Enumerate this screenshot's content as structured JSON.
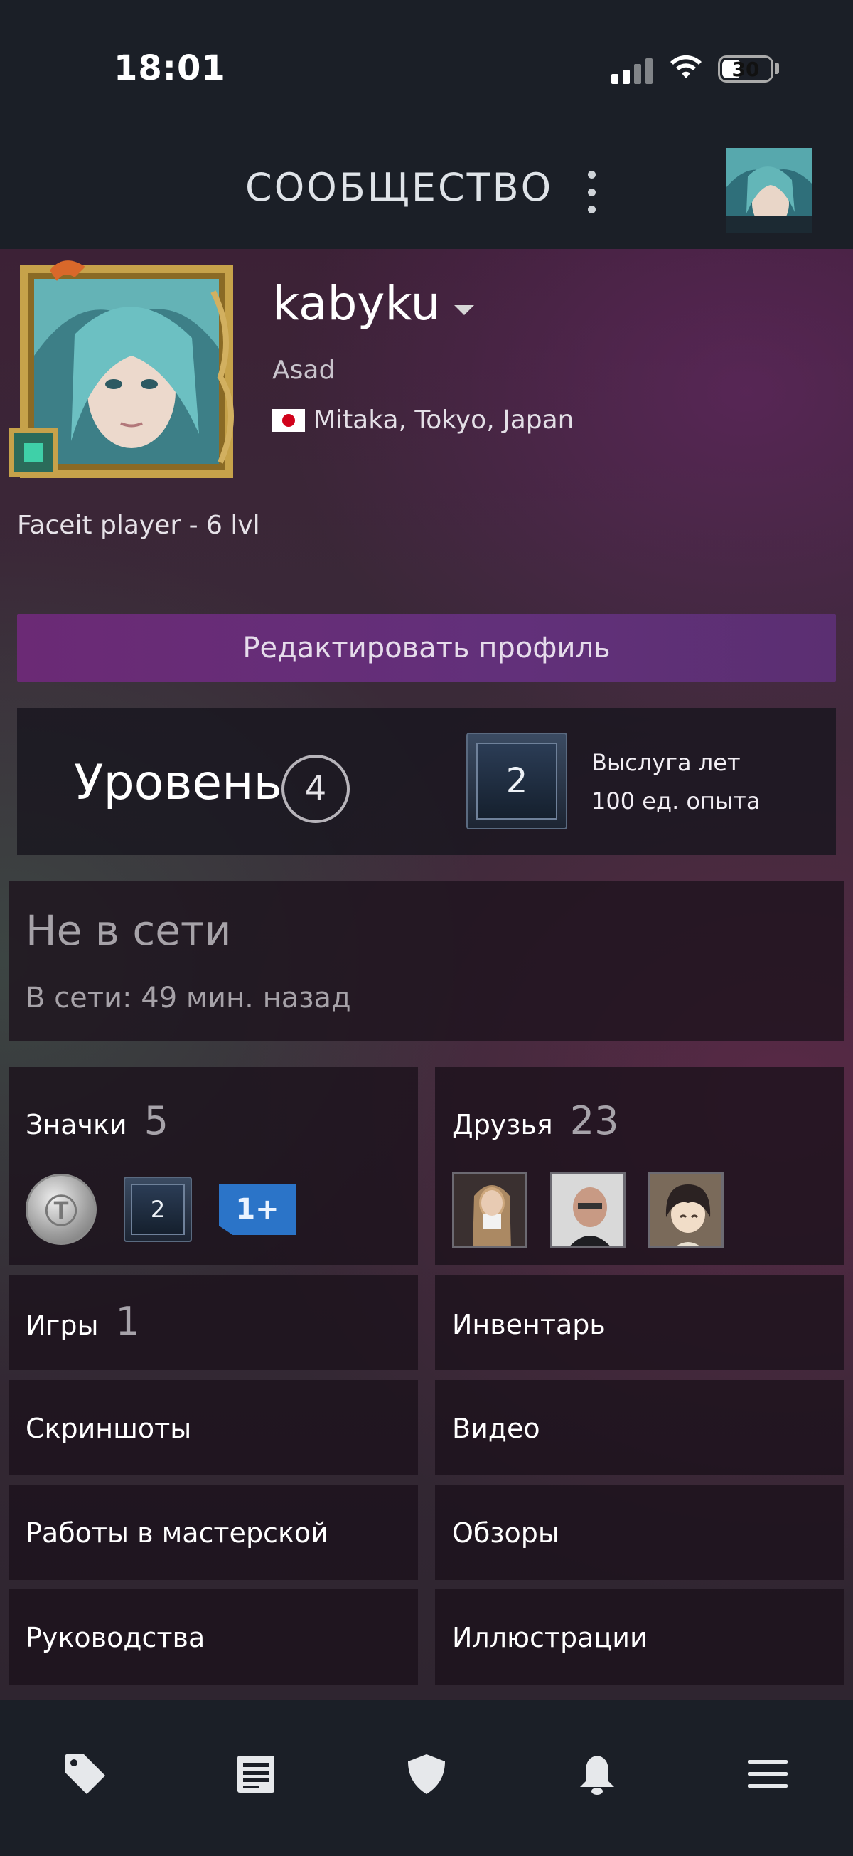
{
  "status_bar": {
    "time": "18:01",
    "battery": "30"
  },
  "header": {
    "title": "СООБЩЕСТВО"
  },
  "profile": {
    "username": "kabyku",
    "real_name": "Asad",
    "location": "Mitaka, Tokyo, Japan",
    "summary": "Faceit player - 6 lvl",
    "edit_button": "Редактировать профиль"
  },
  "level": {
    "label": "Уровень",
    "value": "4",
    "badge_level": "2",
    "badge_title": "Выслуга лет",
    "badge_xp": "100 ед. опыта"
  },
  "status": {
    "state": "Не в сети",
    "last_online": "В сети: 49 мин. назад"
  },
  "badges_tile": {
    "label": "Значки",
    "count": "5",
    "badge_items": [
      "coin-badge",
      "years-badge",
      "1+"
    ],
    "years_value": "2"
  },
  "friends_tile": {
    "label": "Друзья",
    "count": "23"
  },
  "games_tile": {
    "label": "Игры",
    "count": "1"
  },
  "tiles": {
    "inventory": "Инвентарь",
    "screenshots": "Скриншоты",
    "videos": "Видео",
    "workshop": "Работы в мастерской",
    "reviews": "Обзоры",
    "guides": "Руководства",
    "artwork": "Иллюстрации"
  },
  "bottom_nav": [
    "tag-icon",
    "news-icon",
    "shield-icon",
    "bell-icon",
    "menu-icon"
  ],
  "colors": {
    "edit_button": "#6b2a75",
    "page_bg": "#1b1f27",
    "badge_blue": "#2b74c8"
  }
}
